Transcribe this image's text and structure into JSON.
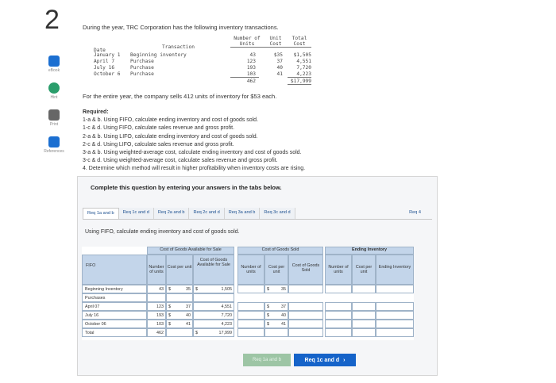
{
  "question_number": "2",
  "sidebar": {
    "items": [
      {
        "label": "eBook",
        "icon": "book-icon",
        "color": "#1b6fd1"
      },
      {
        "label": "Hint",
        "icon": "hint-icon",
        "color": "#2a9d6b"
      },
      {
        "label": "Print",
        "icon": "print-icon",
        "color": "#666666"
      },
      {
        "label": "References",
        "icon": "references-icon",
        "color": "#1b6fd1"
      }
    ]
  },
  "intro_text": "During the year, TRC Corporation has the following inventory transactions.",
  "transactions": {
    "headers": [
      "Date",
      "Transaction",
      "Number of Units",
      "Unit Cost",
      "Total Cost"
    ],
    "rows": [
      {
        "date": "January 1",
        "transaction": "Beginning inventory",
        "units": "43",
        "unit_cost": "$35",
        "total": "$1,505"
      },
      {
        "date": "April 7",
        "transaction": "Purchase",
        "units": "123",
        "unit_cost": "37",
        "total": "4,551"
      },
      {
        "date": "July 16",
        "transaction": "Purchase",
        "units": "193",
        "unit_cost": "40",
        "total": "7,720"
      },
      {
        "date": "October 6",
        "transaction": "Purchase",
        "units": "103",
        "unit_cost": "41",
        "total": "4,223"
      }
    ],
    "total_units": "462",
    "total_cost": "$17,999"
  },
  "sentence": "For the entire year, the company sells 412 units of inventory for $53 each.",
  "required": {
    "heading": "Required:",
    "items": [
      "1-a & b. Using FIFO, calculate ending inventory and cost of goods sold.",
      "1-c & d. Using FIFO, calculate sales revenue and gross profit.",
      "2-a & b. Using LIFO, calculate ending inventory and cost of goods sold.",
      "2-c & d. Using LIFO, calculate sales revenue and gross profit.",
      "3-a & b. Using weighted-average cost, calculate ending inventory and cost of goods sold.",
      "3-c & d. Using weighted-average cost, calculate sales revenue and gross profit.",
      "4. Determine which method will result in higher profitability when inventory costs are rising."
    ]
  },
  "complete_text": "Complete this question by entering your answers in the tabs below.",
  "tabs": [
    "Req 1a and b",
    "Req 1c and d",
    "Req 2a and b",
    "Req 2c and d",
    "Req 3a and b",
    "Req 3c and d",
    "Req 4"
  ],
  "subhead": "Using FIFO, calculate ending inventory and cost of goods sold.",
  "fifo_table": {
    "corner_label": "FIFO",
    "group_headers": [
      "Cost of Goods Available for Sale",
      "Cost of Goods Sold",
      "Ending Inventory"
    ],
    "col_headers": [
      "Number of units",
      "Cost per unit",
      "Cost of Goods Available for Sale",
      "Number of units",
      "Cost per unit",
      "Cost of Goods Sold",
      "Number of units",
      "Cost per unit",
      "Ending Inventory"
    ],
    "rows": [
      {
        "label": "Beginning Inventory",
        "units": "43",
        "cost": "35",
        "total": "1,505",
        "sold_cost": "35"
      },
      {
        "label": "Purchases",
        "units": "",
        "cost": "",
        "total": "",
        "sold_cost": ""
      },
      {
        "label": "April 07",
        "units": "123",
        "cost": "37",
        "total": "4,551",
        "sold_cost": "37"
      },
      {
        "label": "July 16",
        "units": "193",
        "cost": "40",
        "total": "7,720",
        "sold_cost": "40"
      },
      {
        "label": "October 06",
        "units": "103",
        "cost": "41",
        "total": "4,223",
        "sold_cost": "41"
      },
      {
        "label": "Total",
        "units": "462",
        "cost": "",
        "total": "17,999",
        "sold_cost": ""
      }
    ],
    "dollar": "$"
  },
  "buttons": {
    "prev_label": "Req 1a and b",
    "next_label": "Req 1c and d",
    "next_arrow": "›"
  },
  "colors": {
    "header_blue": "#c3d5ea",
    "next_button": "#1563c9",
    "prev_button": "#9dc5a5",
    "tab_link": "#1b4f8f"
  }
}
